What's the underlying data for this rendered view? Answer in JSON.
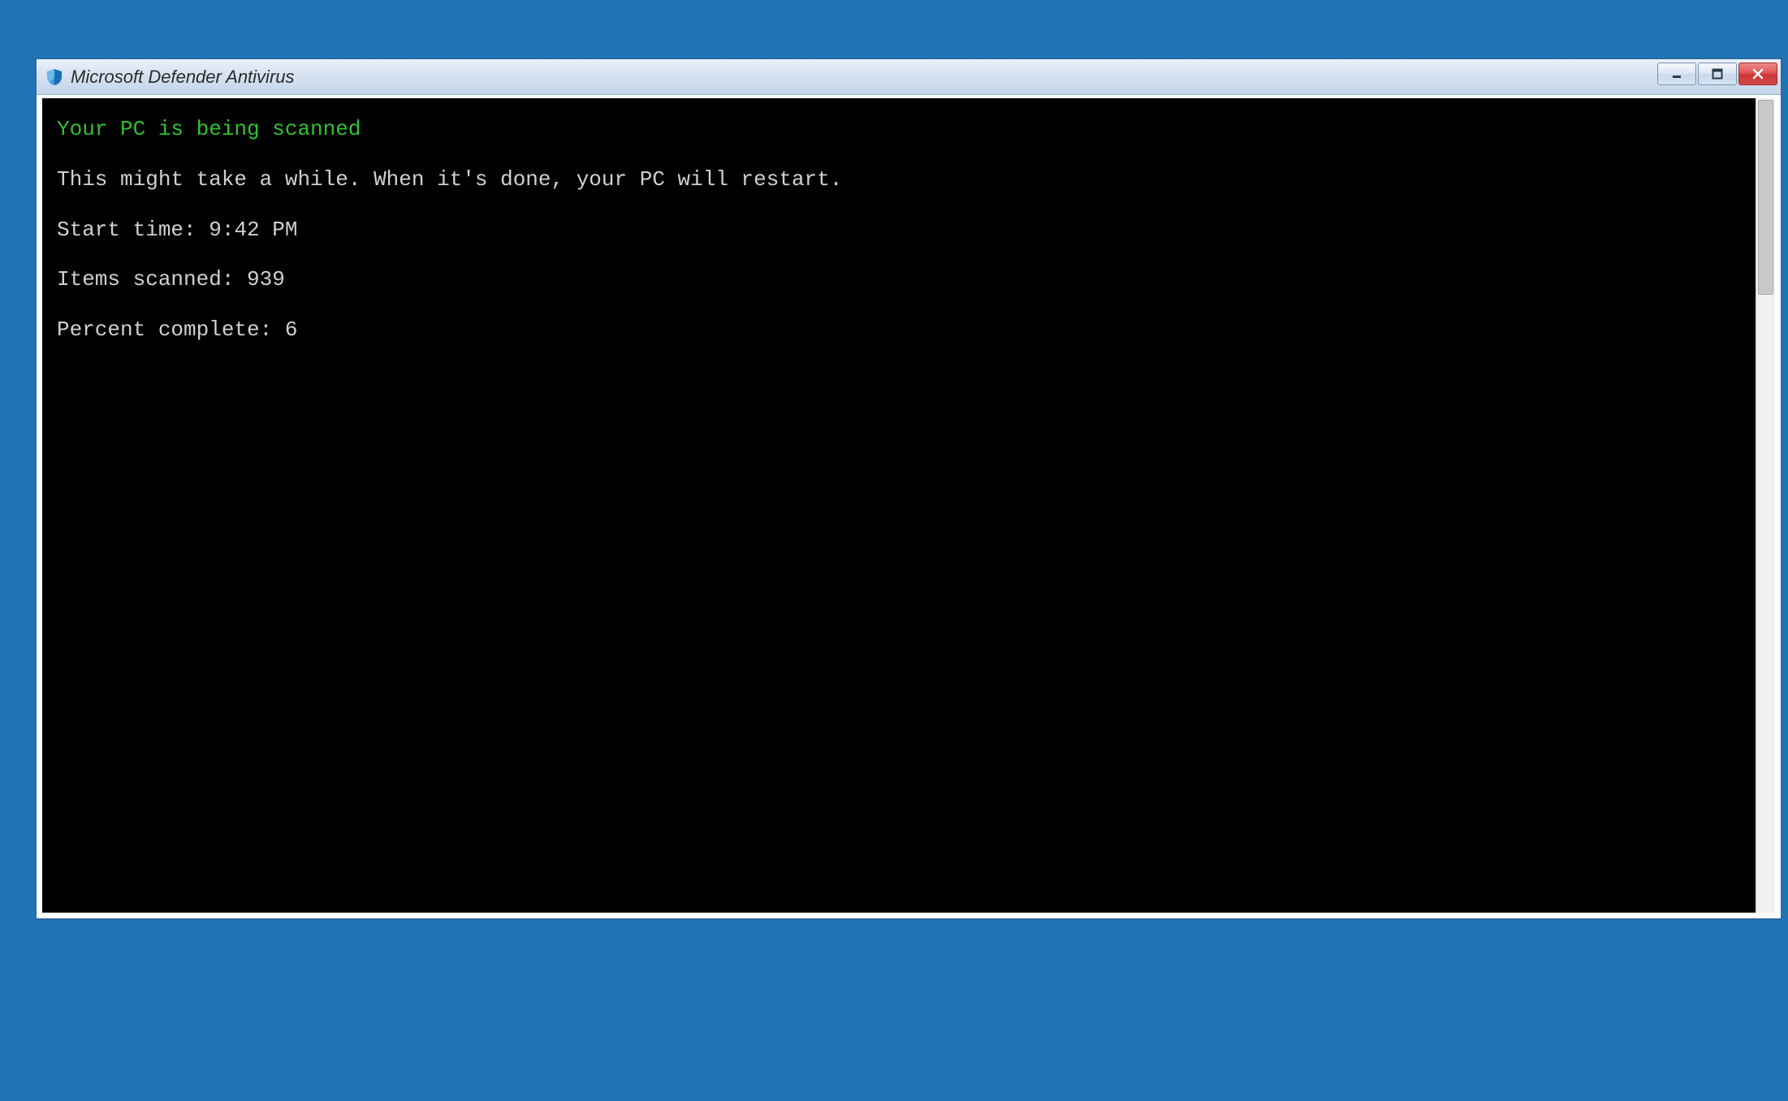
{
  "window": {
    "title": "Microsoft Defender Antivirus"
  },
  "console": {
    "heading": "Your PC is being scanned",
    "subheading": "This might take a while. When it's done, your PC will restart.",
    "start_time_label": "Start time: ",
    "start_time_value": "9:42 PM",
    "items_scanned_label": "Items scanned: ",
    "items_scanned_value": "939",
    "percent_complete_label": "Percent complete: ",
    "percent_complete_value": "6"
  }
}
